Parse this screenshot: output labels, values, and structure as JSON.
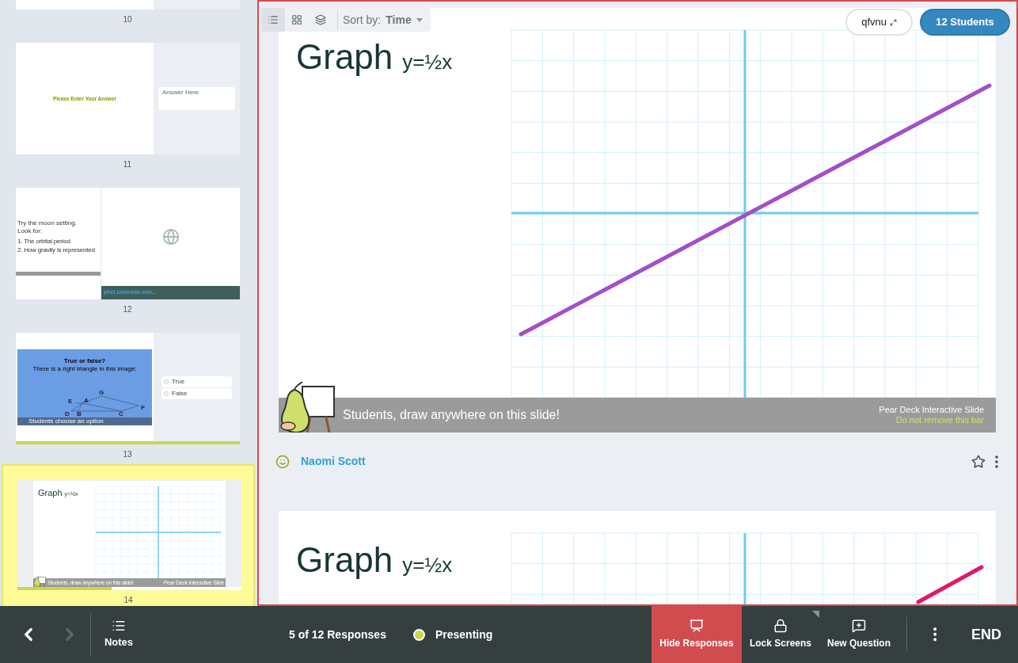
{
  "sidebar": {
    "slides": [
      {
        "number": "10",
        "kind": "partial",
        "selected": false
      },
      {
        "number": "11",
        "kind": "text_entry",
        "selected": false,
        "prompt": "Please Enter Your Answer",
        "answer_hint": "Answer Here"
      },
      {
        "number": "12",
        "kind": "website",
        "selected": false,
        "lines": [
          "Try the moon setting.",
          "Look for:"
        ],
        "list": [
          "1. The orbital period",
          "2. How gravity is represented"
        ],
        "link": "phet.colorado.edu..."
      },
      {
        "number": "13",
        "kind": "choice",
        "selected": false,
        "title": "True or false?",
        "question": "There is a right triangle in this image:",
        "points": [
          "G",
          "E",
          "A",
          "F",
          "D",
          "B",
          "C"
        ],
        "footer": "Students choose an option",
        "options": [
          "True",
          "False"
        ],
        "level": 1
      },
      {
        "number": "14",
        "kind": "draw",
        "selected": true,
        "title": "Graph",
        "formula": "y=½x",
        "footer": "Students, draw anywhere on this slide!",
        "badge": "Pear Deck Interactive Slide",
        "level": 0.42
      }
    ]
  },
  "toolbar": {
    "views": [
      {
        "kind": "list",
        "selected": true
      },
      {
        "kind": "grid",
        "selected": false
      },
      {
        "kind": "layers",
        "selected": false
      }
    ],
    "sort_label": "Sort by:",
    "sort_value": "Time"
  },
  "session_code": "qfvnu",
  "students_button": "12 Students",
  "responses": [
    {
      "title": "Graph",
      "formula": "y=½x",
      "footer": "Students, draw anywhere on this slide!",
      "badge": "Pear Deck Interactive Slide",
      "badge_note": "Do not remove this bar",
      "color": "#a44ec8",
      "student": "Naomi Scott",
      "starred": false
    },
    {
      "title": "Graph",
      "formula": "y=½x",
      "color": "#e0196b"
    }
  ],
  "bottom_bar": {
    "back_disabled": false,
    "forward_disabled": true,
    "notes": "Notes",
    "responses_count": "5 of 12 Responses",
    "status": "Presenting",
    "actions": [
      {
        "kind": "hide",
        "label": "Hide Responses",
        "active": true
      },
      {
        "kind": "lock",
        "label": "Lock Screens",
        "active": false
      },
      {
        "kind": "new",
        "label": "New Question",
        "active": false
      }
    ],
    "end": "END"
  }
}
